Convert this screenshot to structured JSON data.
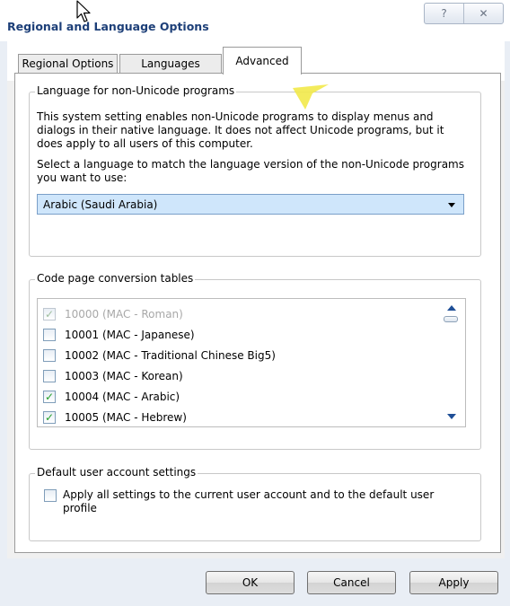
{
  "window": {
    "title": "Regional and Language Options",
    "controls": {
      "help": "?",
      "close": "✕"
    }
  },
  "tabs": [
    {
      "label": "Regional Options",
      "active": false
    },
    {
      "label": "Languages",
      "active": false
    },
    {
      "label": "Advanced",
      "active": true
    }
  ],
  "non_unicode": {
    "legend": "Language for non-Unicode programs",
    "description": "This system setting enables non-Unicode programs to display menus and dialogs in their native language. It does not affect Unicode programs, but it does apply to all users of this computer.",
    "select_prompt": "Select a language to match the language version of the non-Unicode programs you want to use:",
    "selected_language": "Arabic (Saudi Arabia)"
  },
  "code_pages": {
    "legend": "Code page conversion tables",
    "items": [
      {
        "label": "10000 (MAC - Roman)",
        "checked": true,
        "disabled": true
      },
      {
        "label": "10001 (MAC - Japanese)",
        "checked": false,
        "disabled": false
      },
      {
        "label": "10002 (MAC - Traditional Chinese Big5)",
        "checked": false,
        "disabled": false
      },
      {
        "label": "10003 (MAC - Korean)",
        "checked": false,
        "disabled": false
      },
      {
        "label": "10004 (MAC - Arabic)",
        "checked": true,
        "disabled": false
      },
      {
        "label": "10005 (MAC - Hebrew)",
        "checked": true,
        "disabled": false
      }
    ]
  },
  "default_user": {
    "legend": "Default user account settings",
    "checkbox_label": "Apply all settings to the current user account and to the default user profile",
    "checked": false
  },
  "buttons": {
    "ok": "OK",
    "cancel": "Cancel",
    "apply": "Apply"
  },
  "colors": {
    "title_text": "#1d3f78",
    "dropdown_highlight": "#cfe6fb",
    "tooltip_pointer": "#f2e94a",
    "check_mark": "#25a02a",
    "scroll_arrow": "#1f4f97"
  },
  "icons": {
    "check": "✓",
    "cursor": "mouse-cursor-icon",
    "dropdown": "chevron-down-icon"
  }
}
